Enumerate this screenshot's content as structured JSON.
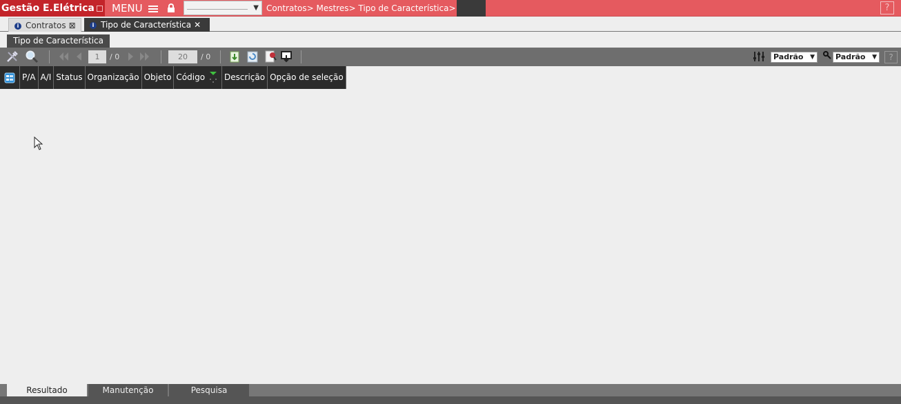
{
  "header": {
    "app_title": "Gestão E.Elétrica",
    "menu_label": "MENU",
    "breadcrumb": "Contratos> Mestres> Tipo de Característica>",
    "help_label": "?"
  },
  "tabs": [
    {
      "label": "Contratos",
      "close": "⊠"
    },
    {
      "label": "Tipo de Característica",
      "close": "✕"
    }
  ],
  "sub_tab": {
    "label": "Tipo de Característica"
  },
  "toolbar": {
    "page_current": "1",
    "page_total": "/ 0",
    "rows_per_page": "20",
    "rows_total": "/ 0",
    "view_select": "Padrão",
    "filter_select": "Padrão",
    "help_label": "?"
  },
  "grid": {
    "columns": [
      "P/A",
      "A/I",
      "Status",
      "Organização",
      "Objeto",
      "Código",
      "Descrição",
      "Opção de seleção"
    ]
  },
  "bottom_tabs": [
    "Resultado",
    "Manutenção",
    "Pesquisa"
  ],
  "colors": {
    "topbar": "#e55a5f",
    "title_bg": "#c3242a",
    "toolbar_bg": "#6e6e6e",
    "header_bg": "#2b2b2b"
  }
}
